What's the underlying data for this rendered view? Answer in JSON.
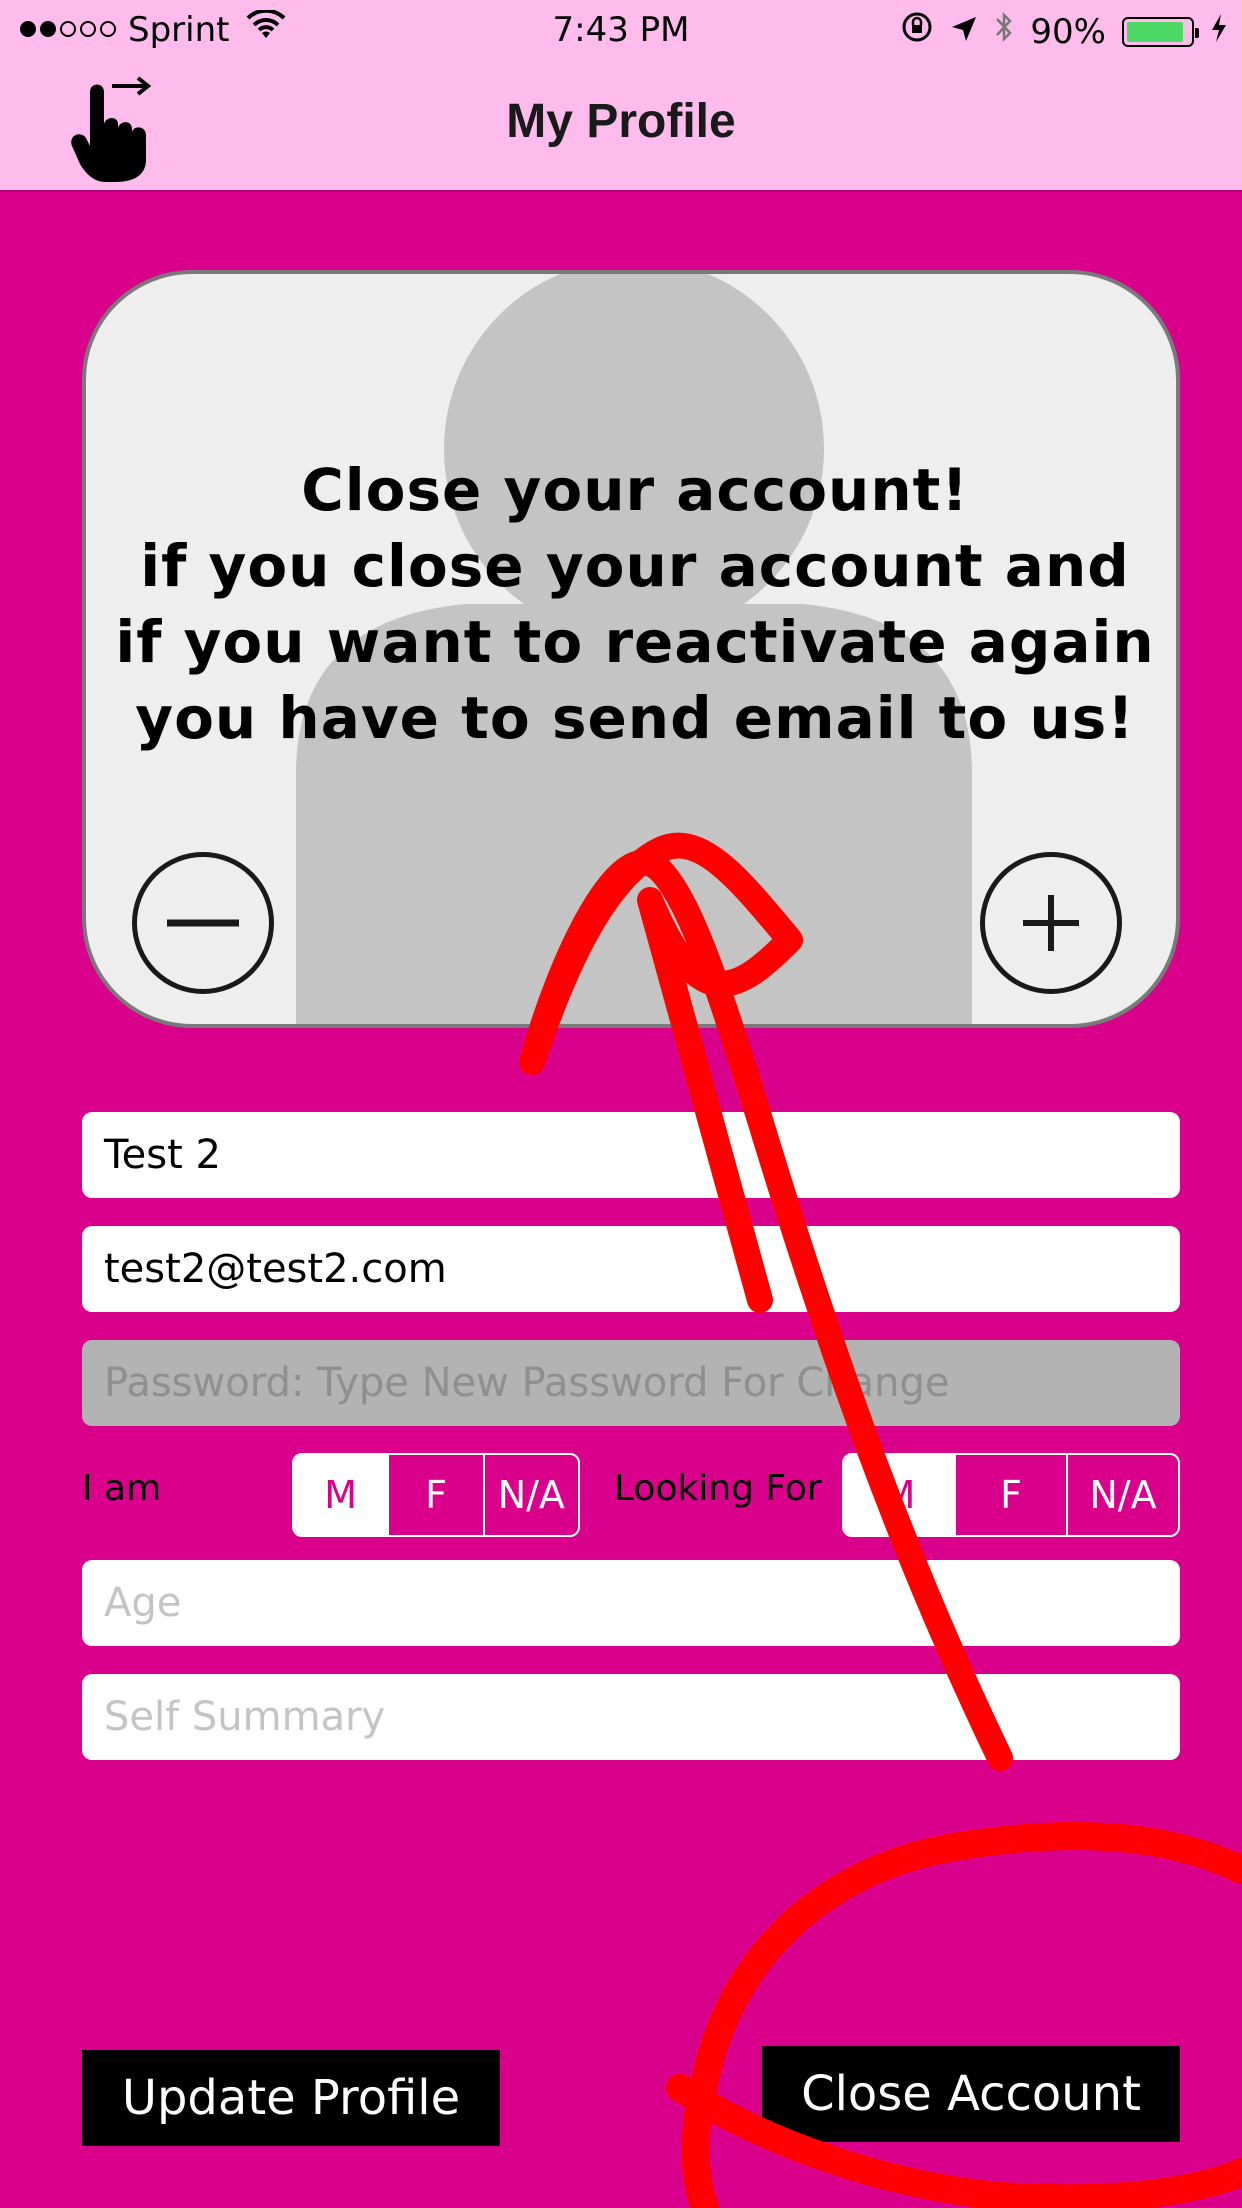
{
  "status_bar": {
    "carrier": "Sprint",
    "time": "7:43 PM",
    "battery": "90%",
    "battery_level": 0.9,
    "icons": [
      "signal-dots-icon",
      "wifi-icon",
      "rotation-lock-icon",
      "location-arrow-icon",
      "bluetooth-icon",
      "battery-icon",
      "charging-bolt-icon"
    ]
  },
  "nav": {
    "title": "My Profile",
    "menu_icon": "hand-swipe-icon"
  },
  "photo": {
    "notice_lines": [
      "Close your account!",
      "if you close your account and",
      "if you want to reactivate again",
      "you have to send email to us!"
    ],
    "icons": [
      "avatar-placeholder-icon",
      "minus-icon",
      "plus-icon"
    ]
  },
  "form": {
    "name_value": "Test 2",
    "email_value": "test2@test2.com",
    "password_placeholder": "Password: Type New Password For Change",
    "iam_label": "I am",
    "iam_options": [
      "M",
      "F",
      "N/A"
    ],
    "iam_selected": "M",
    "looking_label": "Looking For",
    "looking_options": [
      "M",
      "F",
      "N/A"
    ],
    "looking_selected": "M",
    "age_placeholder": "Age",
    "summary_placeholder": "Self Summary"
  },
  "buttons": {
    "update_label": "Update Profile",
    "close_label": "Close Account"
  },
  "colors": {
    "background": "#d9008c",
    "nav_background": "#fdbcec",
    "annotation": "#ff0000"
  }
}
